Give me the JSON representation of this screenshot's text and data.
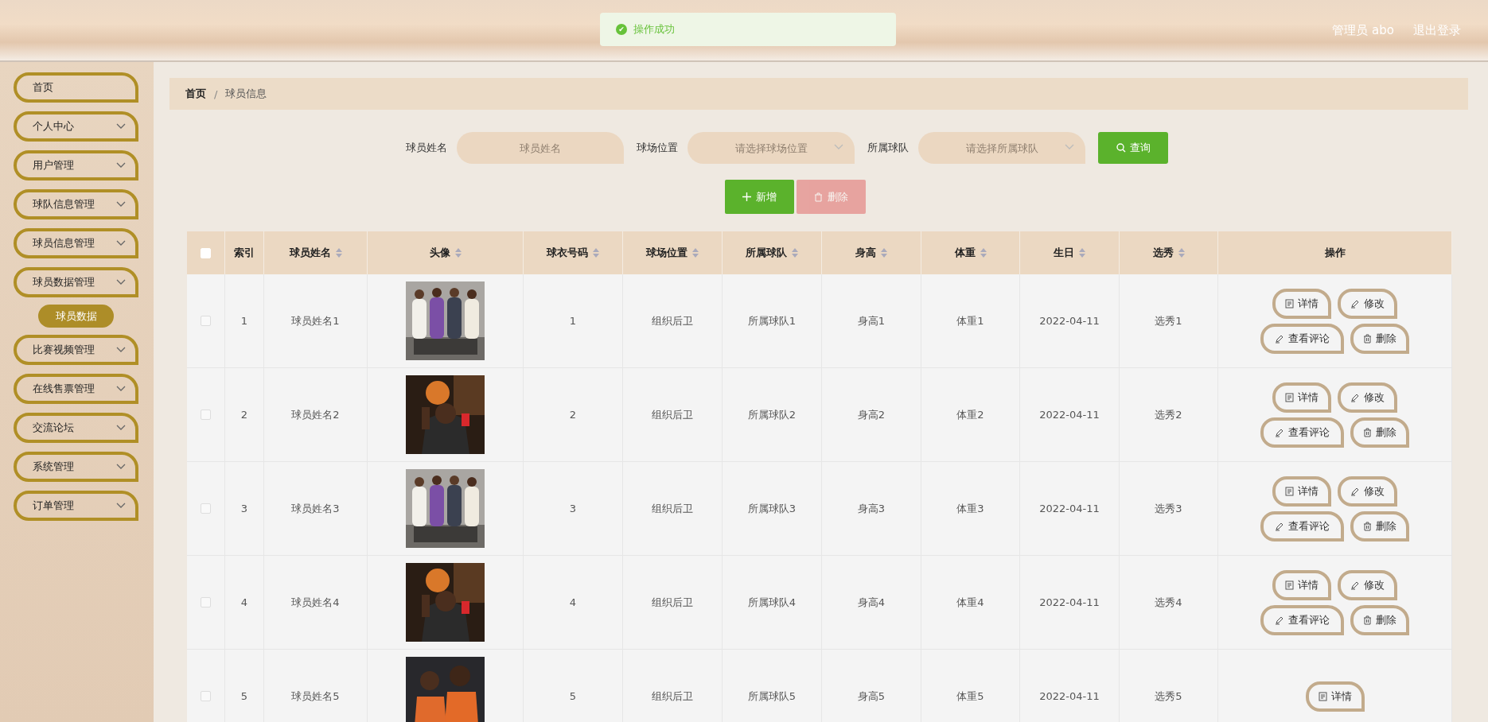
{
  "toast": {
    "icon": "✔",
    "text": "操作成功"
  },
  "header": {
    "user": "管理员 abo",
    "logout": "退出登录"
  },
  "sidebar": {
    "items": [
      {
        "label": "首页",
        "expandable": false
      },
      {
        "label": "个人中心",
        "expandable": true
      },
      {
        "label": "用户管理",
        "expandable": true
      },
      {
        "label": "球队信息管理",
        "expandable": true
      },
      {
        "label": "球员信息管理",
        "expandable": true
      },
      {
        "label": "球员数据管理",
        "expandable": true,
        "children": [
          {
            "label": "球员数据",
            "selected": true
          }
        ]
      },
      {
        "label": "比赛视频管理",
        "expandable": true
      },
      {
        "label": "在线售票管理",
        "expandable": true
      },
      {
        "label": "交流论坛",
        "expandable": true
      },
      {
        "label": "系统管理",
        "expandable": true
      },
      {
        "label": "订单管理",
        "expandable": true
      }
    ]
  },
  "breadcrumb": [
    "首页",
    "球员信息"
  ],
  "breadcrumb_separator": "/",
  "search": {
    "fields": [
      {
        "label": "球员姓名",
        "placeholder": "球员姓名",
        "kind": "input"
      },
      {
        "label": "球场位置",
        "placeholder": "请选择球场位置",
        "kind": "select"
      },
      {
        "label": "所属球队",
        "placeholder": "请选择所属球队",
        "kind": "select"
      }
    ],
    "button": "查询"
  },
  "actions": [
    {
      "label": "新增",
      "kind": "add",
      "disabled": false
    },
    {
      "label": "删除",
      "kind": "delete",
      "disabled": true
    }
  ],
  "table": {
    "all_checked": false,
    "columns": [
      {
        "label": "索引",
        "sortable": false
      },
      {
        "label": "球员姓名",
        "sortable": true
      },
      {
        "label": "头像",
        "sortable": true
      },
      {
        "label": "球衣号码",
        "sortable": true
      },
      {
        "label": "球场位置",
        "sortable": true
      },
      {
        "label": "所属球队",
        "sortable": true
      },
      {
        "label": "身高",
        "sortable": true
      },
      {
        "label": "体重",
        "sortable": true
      },
      {
        "label": "生日",
        "sortable": true
      },
      {
        "label": "选秀",
        "sortable": true
      },
      {
        "label": "操作",
        "sortable": false
      }
    ],
    "rows": [
      {
        "checked": false,
        "cells": [
          "1",
          "球员姓名1",
          {
            "kind": "picture"
          },
          "1",
          "组织后卫",
          "所属球队1",
          "身高1",
          "体重1",
          "2022-04-11",
          "选秀1"
        ],
        "buttons": [
          {
            "kind": "detail",
            "label": "详情"
          },
          {
            "kind": "edit",
            "label": "修改"
          },
          {
            "kind": "edit",
            "label": "查看评论"
          },
          {
            "kind": "delete",
            "label": "删除"
          }
        ]
      },
      {
        "checked": false,
        "cells": [
          "2",
          "球员姓名2",
          {
            "kind": "picture"
          },
          "2",
          "组织后卫",
          "所属球队2",
          "身高2",
          "体重2",
          "2022-04-11",
          "选秀2"
        ],
        "buttons": [
          {
            "kind": "detail",
            "label": "详情"
          },
          {
            "kind": "edit",
            "label": "修改"
          },
          {
            "kind": "edit",
            "label": "查看评论"
          },
          {
            "kind": "delete",
            "label": "删除"
          }
        ]
      },
      {
        "checked": false,
        "cells": [
          "3",
          "球员姓名3",
          {
            "kind": "picture"
          },
          "3",
          "组织后卫",
          "所属球队3",
          "身高3",
          "体重3",
          "2022-04-11",
          "选秀3"
        ],
        "buttons": [
          {
            "kind": "detail",
            "label": "详情"
          },
          {
            "kind": "edit",
            "label": "修改"
          },
          {
            "kind": "edit",
            "label": "查看评论"
          },
          {
            "kind": "delete",
            "label": "删除"
          }
        ]
      },
      {
        "checked": false,
        "cells": [
          "4",
          "球员姓名4",
          {
            "kind": "picture"
          },
          "4",
          "组织后卫",
          "所属球队4",
          "身高4",
          "体重4",
          "2022-04-11",
          "选秀4"
        ],
        "buttons": [
          {
            "kind": "detail",
            "label": "详情"
          },
          {
            "kind": "edit",
            "label": "修改"
          },
          {
            "kind": "edit",
            "label": "查看评论"
          },
          {
            "kind": "delete",
            "label": "删除"
          }
        ]
      },
      {
        "checked": false,
        "cells": [
          "5",
          "球员姓名5",
          {
            "kind": "picture"
          },
          "5",
          "组织后卫",
          "所属球队5",
          "身高5",
          "体重5",
          "2022-04-11",
          "选秀5"
        ],
        "buttons": [
          {
            "kind": "detail",
            "label": "详情"
          }
        ]
      }
    ]
  }
}
